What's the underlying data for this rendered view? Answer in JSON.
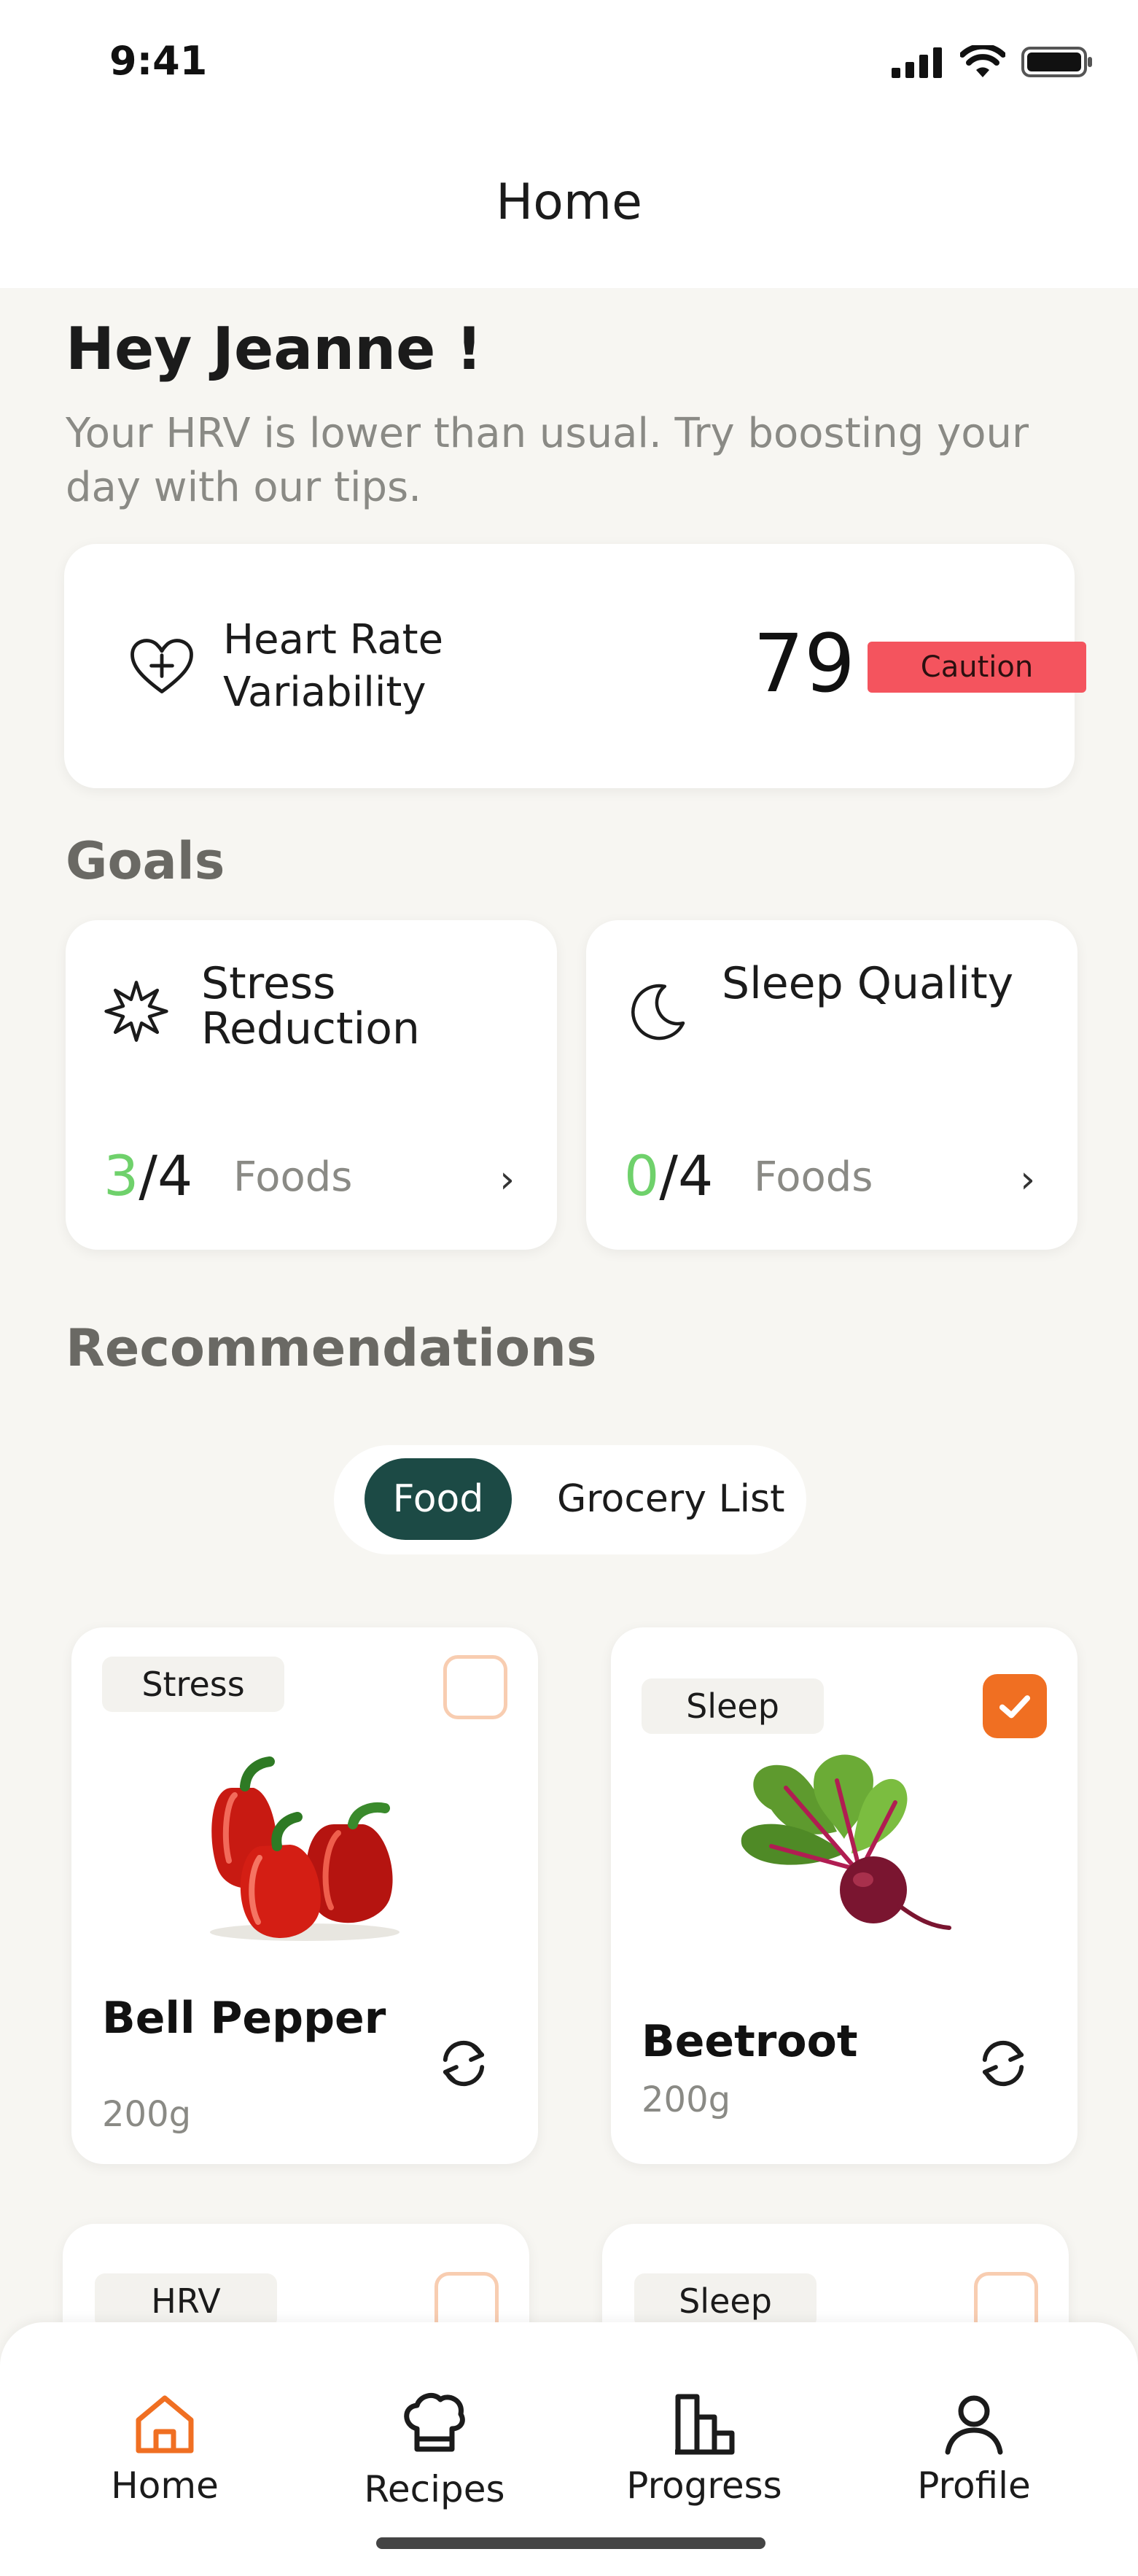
{
  "status_bar": {
    "time": "9:41"
  },
  "nav": {
    "title": "Home"
  },
  "greeting": {
    "title": "Hey Jeanne !",
    "subtitle": "Your HRV is lower than usual. Try boosting your day with our tips."
  },
  "hrv_card": {
    "label": "Heart Rate Variability",
    "value": "79",
    "badge": "Caution",
    "badge_color": "#f4545e"
  },
  "goals": {
    "title": "Goals",
    "items": [
      {
        "title": "Stress Reduction",
        "done": "3",
        "total": "/4",
        "unit": "Foods",
        "icon": "burst-icon"
      },
      {
        "title": "Sleep Quality",
        "done": "0",
        "total": "/4",
        "unit": "Foods",
        "icon": "moon-icon"
      }
    ]
  },
  "recommendations": {
    "title": "Recommendations",
    "tabs": [
      {
        "label": "Food",
        "active": true
      },
      {
        "label": "Grocery List",
        "active": false
      }
    ],
    "foods": [
      {
        "tag": "Stress",
        "name": "Bell Pepper",
        "weight": "200g",
        "checked": false,
        "image": "bell-pepper"
      },
      {
        "tag": "Sleep",
        "name": "Beetroot",
        "weight": "200g",
        "checked": true,
        "image": "beetroot"
      },
      {
        "tag": "HRV",
        "checked": false
      },
      {
        "tag": "Sleep",
        "checked": false
      }
    ]
  },
  "bottom_nav": {
    "items": [
      {
        "label": "Home",
        "icon": "home-icon",
        "active": true
      },
      {
        "label": "Recipes",
        "icon": "chef-hat-icon",
        "active": false
      },
      {
        "label": "Progress",
        "icon": "bar-chart-icon",
        "active": false
      },
      {
        "label": "Profile",
        "icon": "user-icon",
        "active": false
      }
    ]
  },
  "colors": {
    "accent": "#f06f22",
    "dark_green": "#1c4a45",
    "progress_green": "#6fd16b",
    "caution": "#f4545e"
  }
}
